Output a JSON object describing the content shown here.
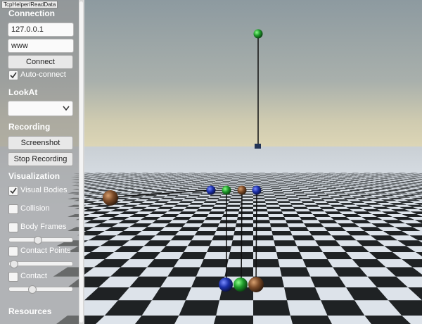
{
  "window": {
    "tag": "TcpHelper/ReadData"
  },
  "connection": {
    "title": "Connection",
    "host_value": "127.0.0.1",
    "name_value": "www",
    "connect_label": "Connect",
    "auto_connect_label": "Auto-connect",
    "auto_connect_checked": true
  },
  "lookat": {
    "title": "LookAt",
    "selected": ""
  },
  "recording": {
    "title": "Recording",
    "screenshot_label": "Screenshot",
    "stop_label": "Stop Recording"
  },
  "visualization": {
    "title": "Visualization",
    "visual_bodies_label": "Visual Bodies",
    "collision_label": "Collision",
    "body_frames_label": "Body Frames",
    "contact_points_label": "Contact Points",
    "contact_label": "Contact",
    "visual_bodies_checked": true,
    "body_frames_slider": 0.45,
    "contact_points_slider": 0.02,
    "contact_slider": 0.35
  },
  "resources": {
    "title": "Resources"
  },
  "colors": {
    "sky": "#8fa0a8",
    "horizon": "#d8d4b8",
    "tile_dark": "#1f2224",
    "tile_light": "#dde3ea",
    "blue_sphere": "#1b2fa8",
    "green_sphere": "#1e9a2a",
    "brown_sphere": "#7a4a28"
  }
}
